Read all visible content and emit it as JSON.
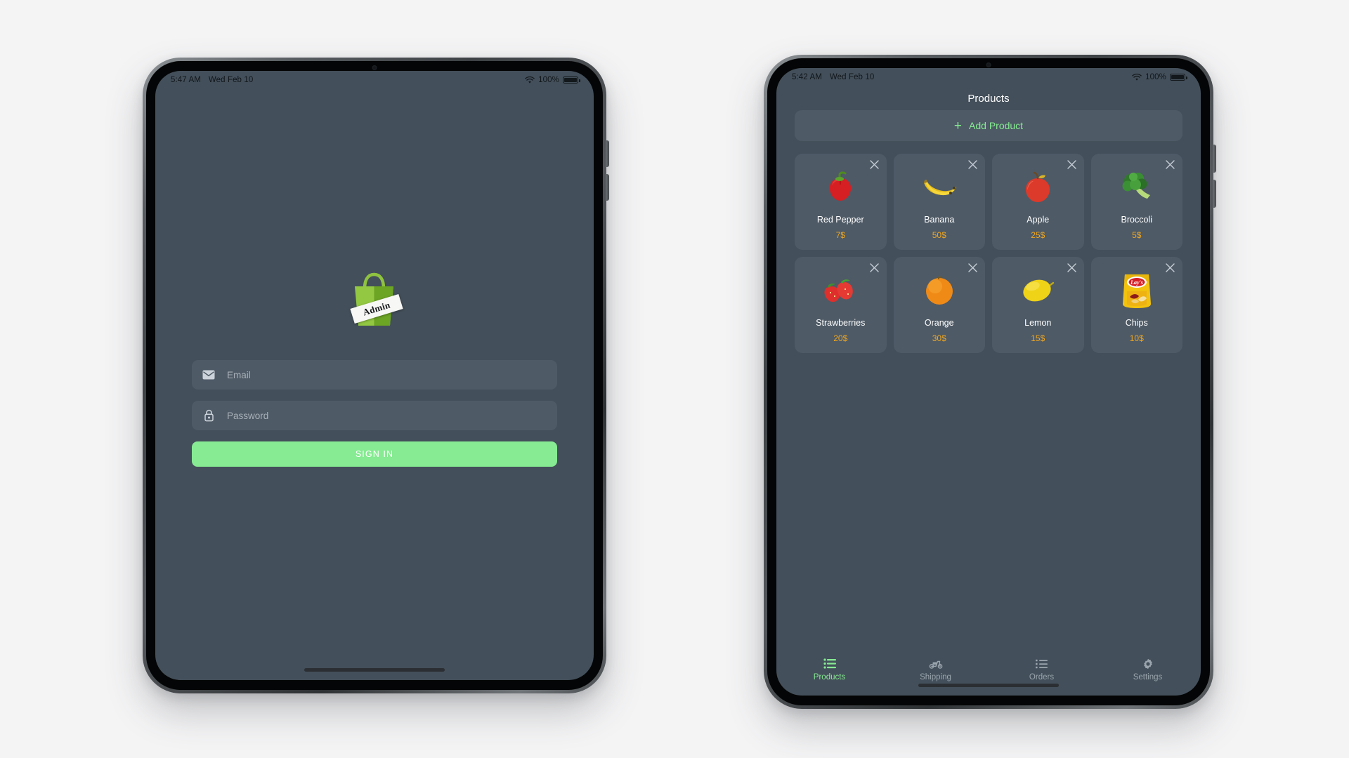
{
  "page": {
    "background": "#f4f4f5"
  },
  "theme": {
    "screen_bg": "#434f5a",
    "surface": "#4e5a66",
    "accent_green": "#86eb92",
    "price_orange": "#f0a720",
    "text_primary": "#ffffff",
    "text_muted": "#9aa5ae"
  },
  "left_device": {
    "status_bar": {
      "time": "5:47 AM",
      "date": "Wed Feb 10",
      "wifi_icon": "wifi-icon",
      "battery_percent": "100%",
      "battery_icon": "battery-full-icon"
    },
    "logo": {
      "icon": "shopping-bag-logo",
      "tag_text": "Admin"
    },
    "form": {
      "email": {
        "icon": "envelope-icon",
        "placeholder": "Email",
        "value": ""
      },
      "password": {
        "icon": "lock-icon",
        "placeholder": "Password",
        "value": ""
      },
      "submit_label": "SIGN IN"
    },
    "home_indicator": "home-indicator"
  },
  "right_device": {
    "status_bar": {
      "time": "5:42 AM",
      "date": "Wed Feb 10",
      "wifi_icon": "wifi-icon",
      "battery_percent": "100%",
      "battery_icon": "battery-full-icon"
    },
    "nav_title": "Products",
    "add_button": {
      "icon": "plus-icon",
      "label": "Add Product"
    },
    "close_icon": "close-x-icon",
    "products": [
      {
        "name": "Red Pepper",
        "price": "7$",
        "image": "red-pepper-image"
      },
      {
        "name": "Banana",
        "price": "50$",
        "image": "banana-image"
      },
      {
        "name": "Apple",
        "price": "25$",
        "image": "apple-image"
      },
      {
        "name": "Broccoli",
        "price": "5$",
        "image": "broccoli-image"
      },
      {
        "name": "Strawberries",
        "price": "20$",
        "image": "strawberries-image"
      },
      {
        "name": "Orange",
        "price": "30$",
        "image": "orange-image"
      },
      {
        "name": "Lemon",
        "price": "15$",
        "image": "lemon-image"
      },
      {
        "name": "Chips",
        "price": "10$",
        "image": "lays-chips-bag-image"
      }
    ],
    "tabs": [
      {
        "label": "Products",
        "icon": "product-list-icon",
        "active": true
      },
      {
        "label": "Shipping",
        "icon": "moped-delivery-icon",
        "active": false
      },
      {
        "label": "Orders",
        "icon": "orders-list-icon",
        "active": false
      },
      {
        "label": "Settings",
        "icon": "gear-icon",
        "active": false
      }
    ],
    "home_indicator": "home-indicator"
  }
}
